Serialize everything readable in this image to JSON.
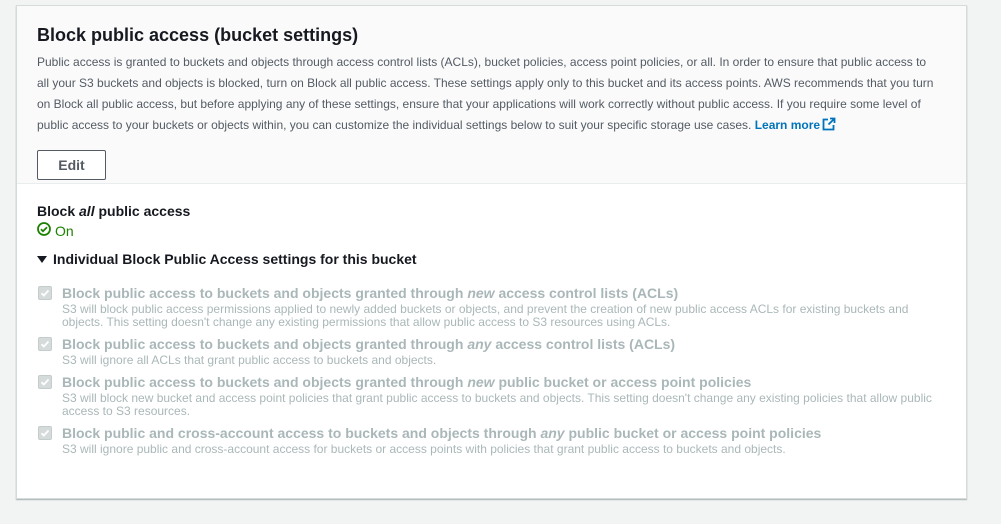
{
  "panel": {
    "title": "Block public access (bucket settings)",
    "description": "Public access is granted to buckets and objects through access control lists (ACLs), bucket policies, access point policies, or all. In order to ensure that public access to all your S3 buckets and objects is blocked, turn on Block all public access. These settings apply only to this bucket and its access points. AWS recommends that you turn on Block all public access, but before applying any of these settings, ensure that your applications will work correctly without public access. If you require some level of public access to your buckets or objects within, you can customize the individual settings below to suit your specific storage use cases.",
    "learn_more_label": "Learn more",
    "edit_label": "Edit"
  },
  "status": {
    "label_prefix": "Block",
    "label_emphasis": "all",
    "label_suffix": "public access",
    "value": "On",
    "success_color": "#1d8102"
  },
  "expander": {
    "label": "Individual Block Public Access settings for this bucket",
    "expanded": true
  },
  "settings": [
    {
      "title_prefix": "Block public access to buckets and objects granted through",
      "title_emphasis": "new",
      "title_suffix": "access control lists (ACLs)",
      "description": "S3 will block public access permissions applied to newly added buckets or objects, and prevent the creation of new public access ACLs for existing buckets and objects. This setting doesn't change any existing permissions that allow public access to S3 resources using ACLs.",
      "checked": true
    },
    {
      "title_prefix": "Block public access to buckets and objects granted through",
      "title_emphasis": "any",
      "title_suffix": "access control lists (ACLs)",
      "description": "S3 will ignore all ACLs that grant public access to buckets and objects.",
      "checked": true
    },
    {
      "title_prefix": "Block public access to buckets and objects granted through",
      "title_emphasis": "new",
      "title_suffix": "public bucket or access point policies",
      "description": "S3 will block new bucket and access point policies that grant public access to buckets and objects. This setting doesn't change any existing policies that allow public access to S3 resources.",
      "checked": true
    },
    {
      "title_prefix": "Block public and cross-account access to buckets and objects through",
      "title_emphasis": "any",
      "title_suffix": "public bucket or access point policies",
      "description": "S3 will ignore public and cross-account access for buckets or access points with policies that grant public access to buckets and objects.",
      "checked": true
    }
  ]
}
